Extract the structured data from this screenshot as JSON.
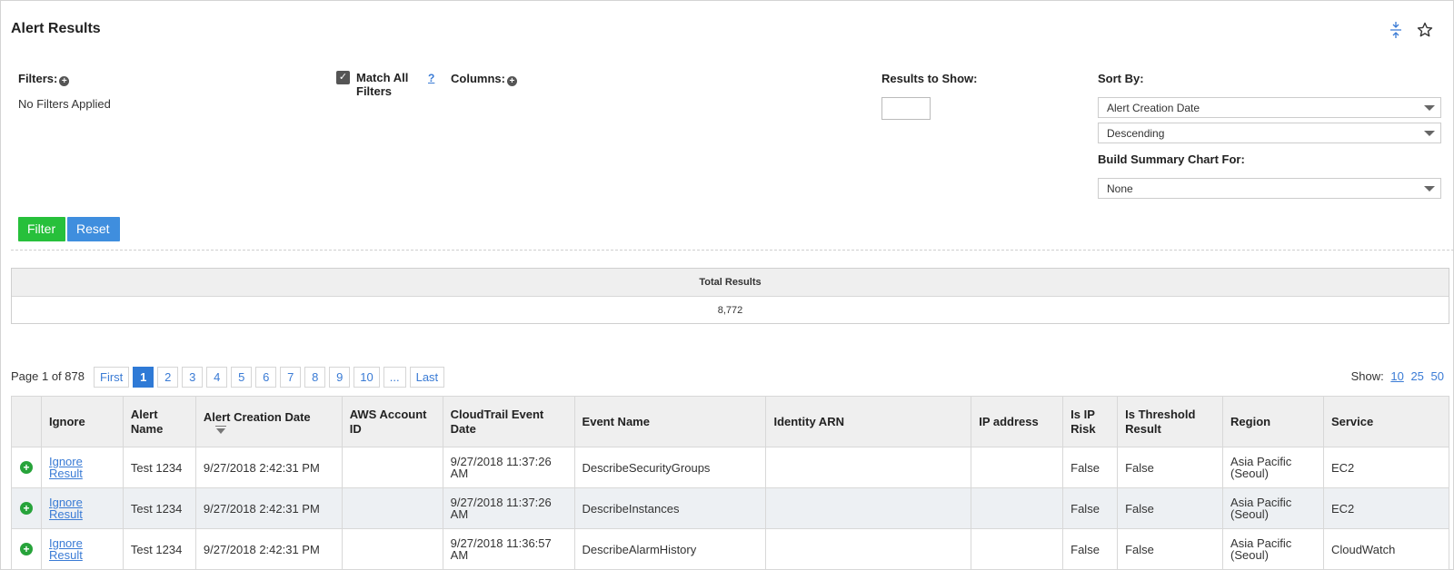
{
  "page": {
    "title": "Alert Results"
  },
  "filters": {
    "filters_label": "Filters:",
    "no_filters": "No Filters Applied",
    "match_all_label_1": "Match All",
    "match_all_label_2": "Filters",
    "help": "?",
    "columns_label": "Columns:",
    "results_to_show_label": "Results to Show:",
    "results_to_show_value": "",
    "sort_by_label": "Sort By:",
    "sort_field": "Alert Creation Date",
    "sort_order": "Descending",
    "summary_label": "Build Summary Chart For:",
    "summary_value": "None",
    "filter_button": "Filter",
    "reset_button": "Reset"
  },
  "total": {
    "header": "Total Results",
    "value": "8,772"
  },
  "pagination": {
    "info": "Page 1 of 878",
    "first": "First",
    "pages": [
      "1",
      "2",
      "3",
      "4",
      "5",
      "6",
      "7",
      "8",
      "9",
      "10"
    ],
    "ellipsis": "...",
    "last": "Last",
    "show_label": "Show:",
    "sizes": [
      "10",
      "25",
      "50"
    ]
  },
  "table": {
    "headers": [
      "Ignore",
      "Alert Name",
      "Alert Creation Date",
      "AWS Account ID",
      "CloudTrail Event Date",
      "Event Name",
      "Identity ARN",
      "IP address",
      "Is IP Risk",
      "Is Threshold Result",
      "Region",
      "Service"
    ],
    "rows": [
      {
        "ignore": "Ignore Result",
        "alert_name": "Test 1234",
        "creation": "9/27/2018 2:42:31 PM",
        "account": "",
        "event_date": "9/27/2018 11:37:26 AM",
        "event_name": "DescribeSecurityGroups",
        "arn": "",
        "ip": "",
        "ip_risk": "False",
        "threshold": "False",
        "region": "Asia Pacific (Seoul)",
        "service": "EC2"
      },
      {
        "ignore": "Ignore Result",
        "alert_name": "Test 1234",
        "creation": "9/27/2018 2:42:31 PM",
        "account": "",
        "event_date": "9/27/2018 11:37:26 AM",
        "event_name": "DescribeInstances",
        "arn": "",
        "ip": "",
        "ip_risk": "False",
        "threshold": "False",
        "region": "Asia Pacific (Seoul)",
        "service": "EC2"
      },
      {
        "ignore": "Ignore Result",
        "alert_name": "Test 1234",
        "creation": "9/27/2018 2:42:31 PM",
        "account": "",
        "event_date": "9/27/2018 11:36:57 AM",
        "event_name": "DescribeAlarmHistory",
        "arn": "",
        "ip": "",
        "ip_risk": "False",
        "threshold": "False",
        "region": "Asia Pacific (Seoul)",
        "service": "CloudWatch"
      }
    ]
  }
}
